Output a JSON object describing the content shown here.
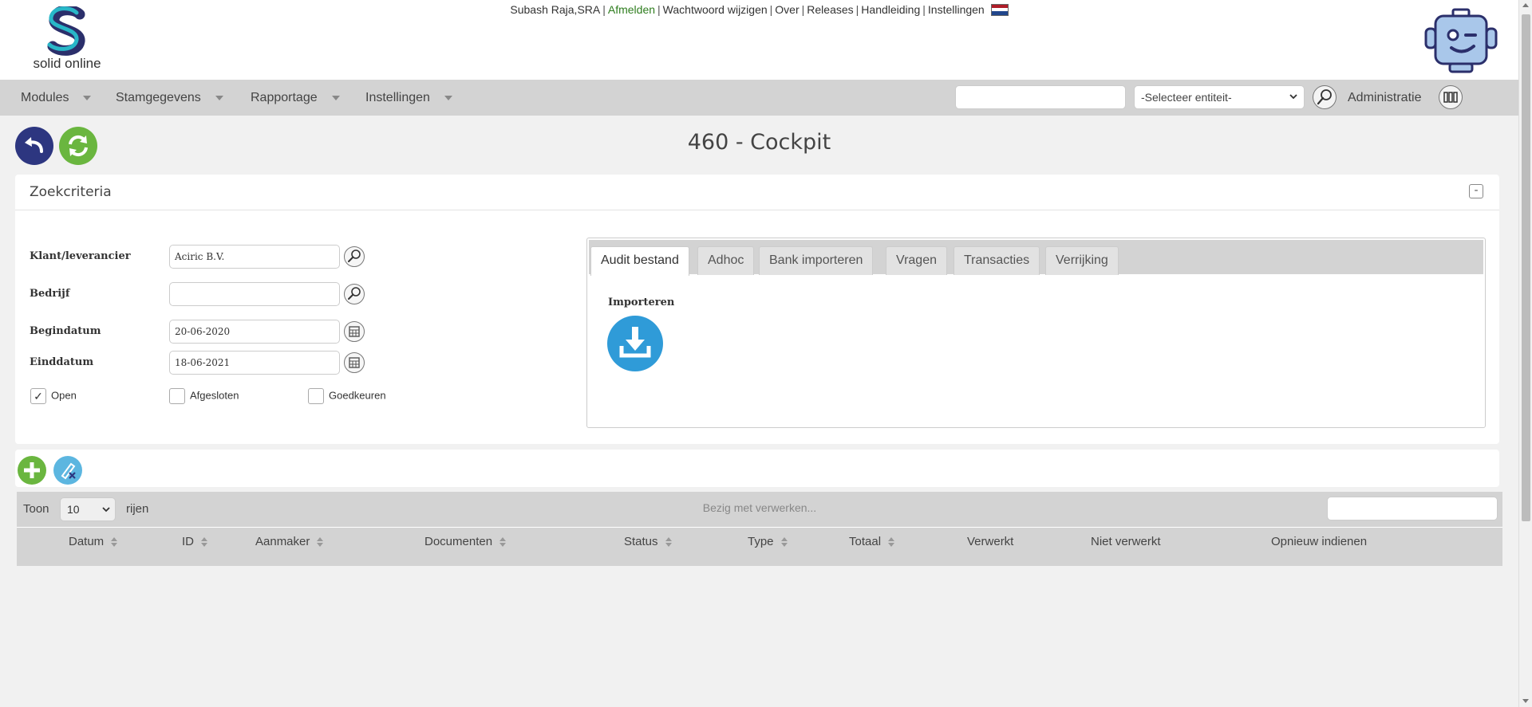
{
  "header": {
    "logo_text": "solid online",
    "user": "Subash Raja,SRA",
    "links": {
      "logout": "Afmelden",
      "change_password": "Wachtwoord wijzigen",
      "about": "Over",
      "releases": "Releases",
      "manual": "Handleiding",
      "settings": "Instellingen"
    },
    "separator": "|"
  },
  "menubar": {
    "items": [
      "Modules",
      "Stamgegevens",
      "Rapportage",
      "Instellingen"
    ],
    "search_value": "",
    "entity_select": "-Selecteer entiteit-",
    "admin_label": "Administratie"
  },
  "page": {
    "title": "460 - Cockpit"
  },
  "search_panel": {
    "title": "Zoekcriteria",
    "collapse_symbol": "-",
    "fields": {
      "customer_label": "Klant/leverancier",
      "customer_value": "Aciric B.V.",
      "company_label": "Bedrijf",
      "company_value": "",
      "start_label": "Begindatum",
      "start_value": "20-06-2020",
      "end_label": "Einddatum",
      "end_value": "18-06-2021"
    },
    "checkboxes": [
      {
        "label": "Open",
        "checked": true,
        "mark": "✓"
      },
      {
        "label": "Afgesloten",
        "checked": false,
        "mark": ""
      },
      {
        "label": "Goedkeuren",
        "checked": false,
        "mark": ""
      }
    ],
    "tabs": [
      "Audit bestand",
      "Adhoc",
      "Bank importeren",
      "Vragen",
      "Transacties",
      "Verrijking"
    ],
    "active_tab": "Audit bestand",
    "import_label": "Importeren"
  },
  "table": {
    "show_label": "Toon",
    "page_length": "10",
    "rows_label": "rijen",
    "processing": "Bezig met verwerken...",
    "search_value": "",
    "columns": [
      "Datum",
      "ID",
      "Aanmaker",
      "Documenten",
      "Status",
      "Type",
      "Totaal",
      "Verwerkt",
      "Niet verwerkt",
      "Opnieuw indienen"
    ]
  },
  "colors": {
    "accent_green": "#6ab63f",
    "navy": "#2d3680",
    "import_blue": "#2f9bd8",
    "menubar": "#d3d3d3"
  }
}
